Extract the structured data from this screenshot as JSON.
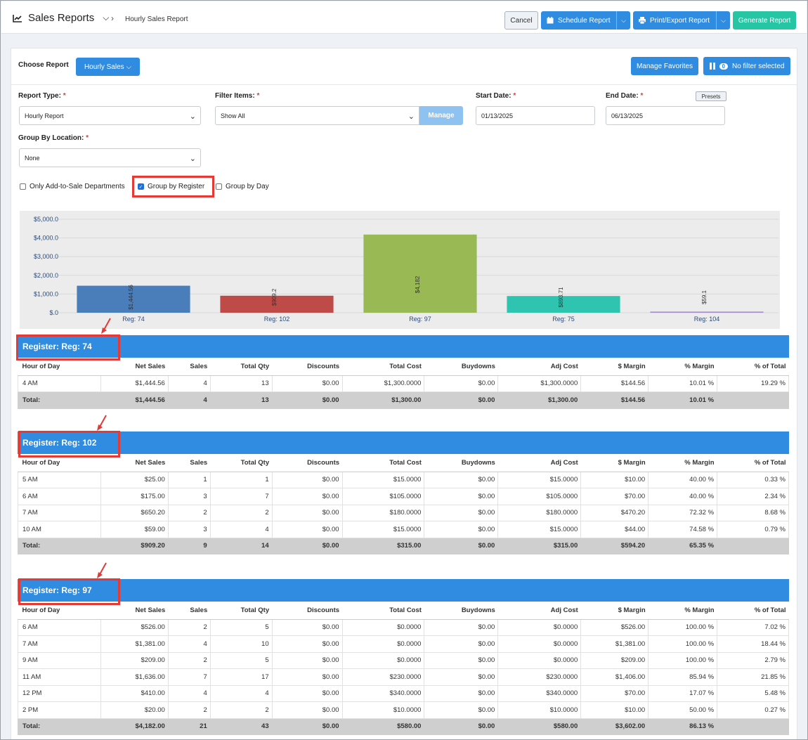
{
  "topbar": {
    "app_title": "Sales Reports",
    "breadcrumb": "Hourly Sales Report",
    "cancel": "Cancel",
    "schedule": "Schedule Report",
    "print_export": "Print/Export Report",
    "generate": "Generate Report"
  },
  "controls": {
    "choose_report_label": "Choose Report",
    "choose_report_value": "Hourly Sales",
    "manage_favorites": "Manage Favorites",
    "filter_count": "0",
    "filter_text": "No filter selected",
    "report_type_label": "Report Type:",
    "report_type_value": "Hourly Report",
    "filter_items_label": "Filter Items:",
    "filter_items_value": "Show All",
    "manage": "Manage",
    "start_date_label": "Start Date:",
    "start_date_value": "01/13/2025",
    "end_date_label": "End Date:",
    "end_date_value": "06/13/2025",
    "presets": "Presets",
    "group_by_location_label": "Group By Location:",
    "group_by_location_value": "None",
    "required_mark": "*",
    "chk_only_add": "Only Add-to-Sale Departments",
    "chk_group_register": "Group by Register",
    "chk_group_day": "Group by Day"
  },
  "chart_data": {
    "type": "bar",
    "categories": [
      "Reg: 74",
      "Reg: 102",
      "Reg: 97",
      "Reg: 75",
      "Reg: 104"
    ],
    "values": [
      1444.56,
      909.2,
      4182,
      893.71,
      59.1
    ],
    "data_labels": [
      "$1,444.56",
      "$909.2",
      "$4,182",
      "$893.71",
      "$59.1"
    ],
    "colors": [
      "#4a7ebb",
      "#be4b48",
      "#98b954",
      "#2ec4b0",
      "#a48bc9"
    ],
    "yticks": [
      "$.0",
      "$1,000.0",
      "$2,000.0",
      "$3,000.0",
      "$4,000.0",
      "$5,000.0"
    ],
    "ylim": [
      0,
      5000
    ],
    "grid": true
  },
  "table_columns": [
    "Hour of Day",
    "Net Sales",
    "Sales",
    "Total Qty",
    "Discounts",
    "Total Cost",
    "Buydowns",
    "Adj Cost",
    "$ Margin",
    "% Margin",
    "% of Total"
  ],
  "sections": [
    {
      "title": "Register: Reg: 74",
      "rows": [
        [
          "4 AM",
          "$1,444.56",
          "4",
          "13",
          "$0.00",
          "$1,300.0000",
          "$0.00",
          "$1,300.0000",
          "$144.56",
          "10.01 %",
          "19.29 %"
        ]
      ],
      "total": [
        "Total:",
        "$1,444.56",
        "4",
        "13",
        "$0.00",
        "$1,300.00",
        "$0.00",
        "$1,300.00",
        "$144.56",
        "10.01 %",
        ""
      ]
    },
    {
      "title": "Register: Reg: 102",
      "rows": [
        [
          "5 AM",
          "$25.00",
          "1",
          "1",
          "$0.00",
          "$15.0000",
          "$0.00",
          "$15.0000",
          "$10.00",
          "40.00 %",
          "0.33 %"
        ],
        [
          "6 AM",
          "$175.00",
          "3",
          "7",
          "$0.00",
          "$105.0000",
          "$0.00",
          "$105.0000",
          "$70.00",
          "40.00 %",
          "2.34 %"
        ],
        [
          "7 AM",
          "$650.20",
          "2",
          "2",
          "$0.00",
          "$180.0000",
          "$0.00",
          "$180.0000",
          "$470.20",
          "72.32 %",
          "8.68 %"
        ],
        [
          "10 AM",
          "$59.00",
          "3",
          "4",
          "$0.00",
          "$15.0000",
          "$0.00",
          "$15.0000",
          "$44.00",
          "74.58 %",
          "0.79 %"
        ]
      ],
      "total": [
        "Total:",
        "$909.20",
        "9",
        "14",
        "$0.00",
        "$315.00",
        "$0.00",
        "$315.00",
        "$594.20",
        "65.35 %",
        ""
      ]
    },
    {
      "title": "Register: Reg: 97",
      "rows": [
        [
          "6 AM",
          "$526.00",
          "2",
          "5",
          "$0.00",
          "$0.0000",
          "$0.00",
          "$0.0000",
          "$526.00",
          "100.00 %",
          "7.02 %"
        ],
        [
          "7 AM",
          "$1,381.00",
          "4",
          "10",
          "$0.00",
          "$0.0000",
          "$0.00",
          "$0.0000",
          "$1,381.00",
          "100.00 %",
          "18.44 %"
        ],
        [
          "9 AM",
          "$209.00",
          "2",
          "5",
          "$0.00",
          "$0.0000",
          "$0.00",
          "$0.0000",
          "$209.00",
          "100.00 %",
          "2.79 %"
        ],
        [
          "11 AM",
          "$1,636.00",
          "7",
          "17",
          "$0.00",
          "$230.0000",
          "$0.00",
          "$230.0000",
          "$1,406.00",
          "85.94 %",
          "21.85 %"
        ],
        [
          "12 PM",
          "$410.00",
          "4",
          "4",
          "$0.00",
          "$340.0000",
          "$0.00",
          "$340.0000",
          "$70.00",
          "17.07 %",
          "5.48 %"
        ],
        [
          "2 PM",
          "$20.00",
          "2",
          "2",
          "$0.00",
          "$10.0000",
          "$0.00",
          "$10.0000",
          "$10.00",
          "50.00 %",
          "0.27 %"
        ]
      ],
      "total": [
        "Total:",
        "$4,182.00",
        "21",
        "43",
        "$0.00",
        "$580.00",
        "$0.00",
        "$580.00",
        "$3,602.00",
        "86.13 %",
        ""
      ]
    }
  ],
  "colors": {
    "primary": "#2f8ce0",
    "generate": "#26c6a4",
    "highlight": "#e53935"
  }
}
